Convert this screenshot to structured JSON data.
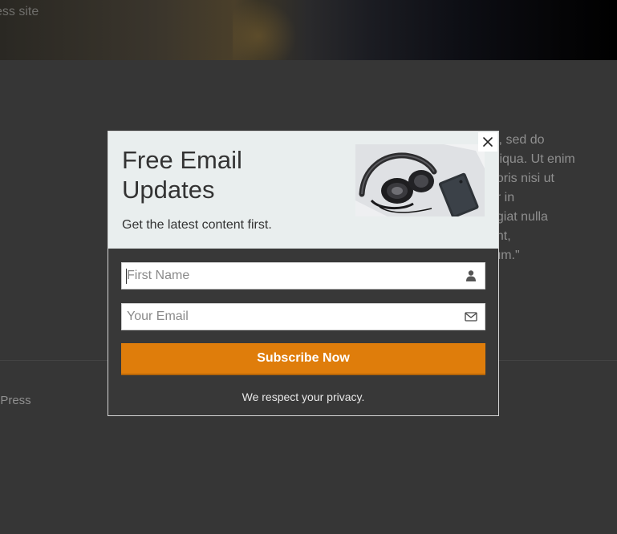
{
  "background": {
    "site_description": "ess site",
    "quote_lines": "lit, sed do\naliqua. Ut enim\nboris nisi ut\nor in\nugiat nulla\nent,\nrum.\"",
    "footer_text": "dPress"
  },
  "modal": {
    "title": "Free Email Updates",
    "subtitle": "Get the latest content first.",
    "first_name_placeholder": "First Name",
    "email_placeholder": "Your Email",
    "subscribe_label": "Subscribe Now",
    "privacy_text": "We respect your privacy.",
    "close_icon": "close-icon",
    "name_icon": "user-icon",
    "email_icon": "envelope-icon",
    "image_description": "headphones-and-phone"
  },
  "colors": {
    "accent": "#df7d0b",
    "modal_header_bg": "#e9eeee",
    "modal_body_bg": "#383838",
    "page_bg": "#363636"
  }
}
